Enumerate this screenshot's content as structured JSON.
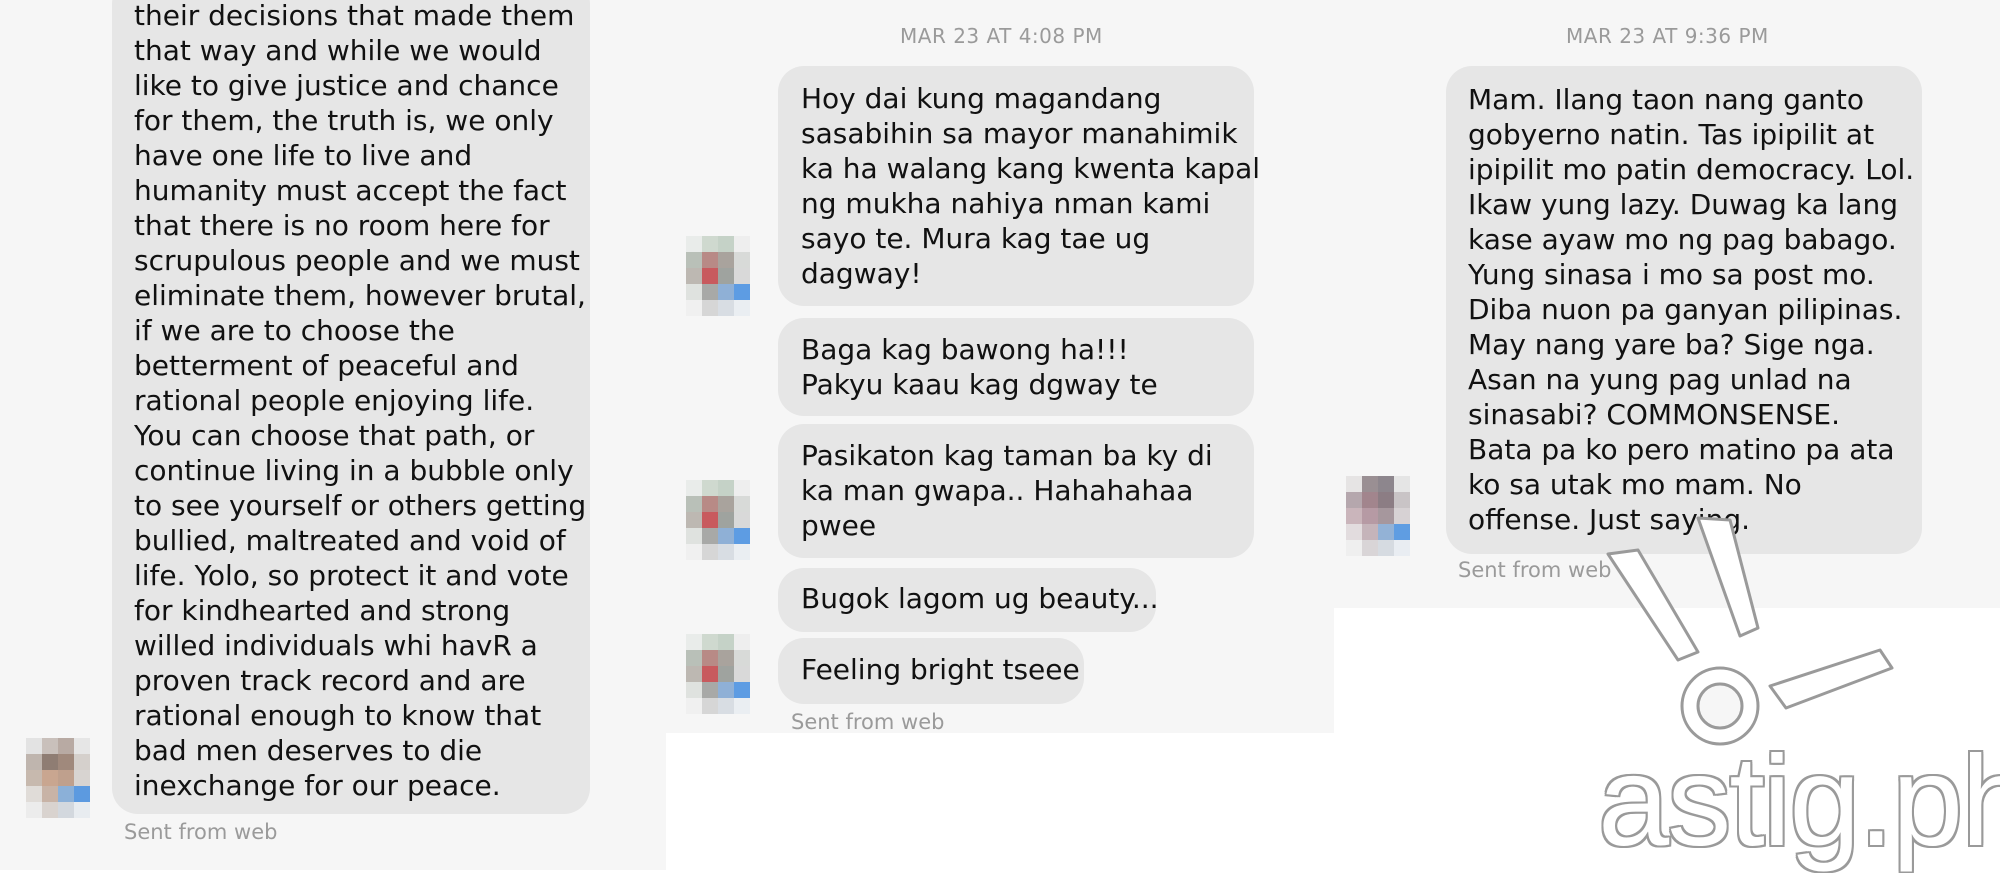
{
  "panel_1": {
    "message_lines": [
      "their decisions that made them",
      "that way and while we would",
      "like to give justice and chance",
      "for them, the truth is, we only",
      "have one life to live and",
      "humanity must accept the fact",
      "that there is no room here for",
      "scrupulous people and we must",
      "eliminate them, however brutal,",
      "if we are to choose the",
      "betterment of peaceful and",
      "rational people enjoying life.",
      "You can choose that path, or",
      "continue living in a bubble only",
      "to see yourself or others getting",
      "bullied, maltreated and void of",
      "life. Yolo, so protect it and vote",
      "for kindhearted and strong",
      "willed individuals whi havR a",
      "proven track record and are",
      "rational enough to know that",
      "bad men deserves to die",
      "inexchange for our peace."
    ],
    "sent_from": "Sent from web"
  },
  "panel_2": {
    "timestamp": "MAR 23 AT 4:08 PM",
    "messages": [
      {
        "lines": [
          "Hoy dai kung magandang",
          "sasabihin sa mayor manahimik",
          "ka ha walang kang kwenta kapal",
          "ng mukha nahiya nman kami",
          "sayo te. Mura kag tae ug",
          "dagway!"
        ]
      },
      {
        "lines": [
          "Baga kag bawong ha!!!",
          "Pakyu kaau kag dgway te"
        ]
      },
      {
        "lines": [
          "Pasikaton kag taman ba ky di",
          "ka man gwapa.. Hahahahaa",
          "pwee"
        ]
      },
      {
        "lines": [
          "Bugok lagom ug beauty..."
        ]
      },
      {
        "lines": [
          "Feeling bright tseee"
        ]
      }
    ],
    "sent_from": "Sent from web"
  },
  "panel_3": {
    "timestamp": "MAR 23 AT 9:36 PM",
    "message_lines": [
      "Mam. Ilang taon nang ganto",
      "gobyerno natin. Tas ipipilit at",
      "ipipilit mo patin democracy. Lol.",
      "Ikaw yung lazy. Duwag ka lang",
      "kase ayaw mo ng pag babago.",
      "Yung sinasa i mo sa post mo.",
      "Diba nuon pa ganyan pilipinas.",
      "May nang yare ba? Sige nga.",
      "Asan na yung pag unlad na",
      "sinasabi? COMMONSENSE.",
      "Bata pa ko pero matino pa ata",
      "ko sa utak mo mam. No",
      "offense. Just saying."
    ],
    "sent_from": "Sent from web"
  },
  "watermark": {
    "text": "astig.ph",
    "logo_icon": "peace-sign-hand-icon"
  },
  "colors": {
    "panel_background": "#f6f6f6",
    "bubble_background": "#e6e6e6",
    "meta_text": "#9a9a9a",
    "message_text": "#111111"
  }
}
